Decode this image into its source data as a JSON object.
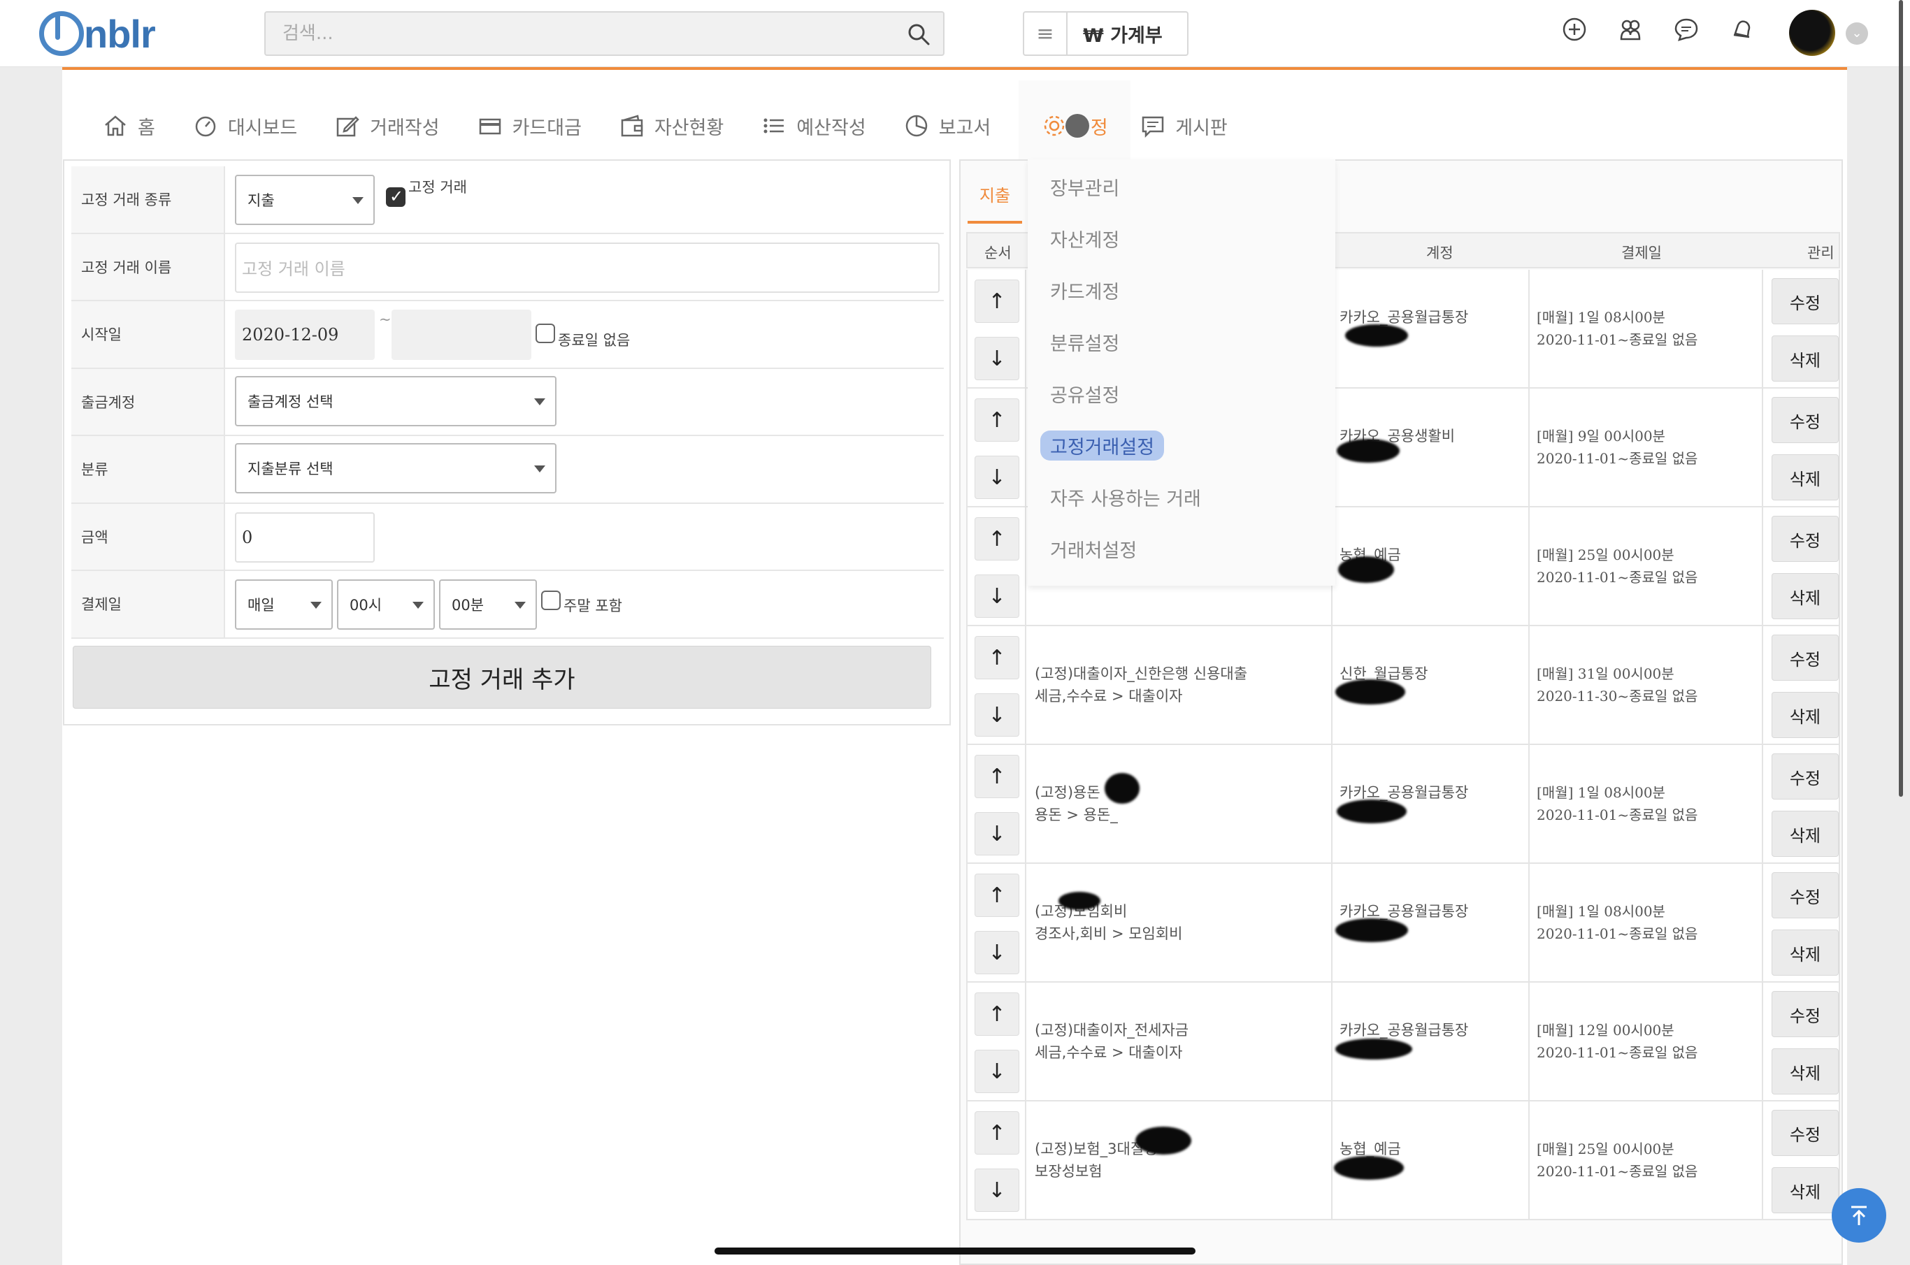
{
  "header": {
    "logo_text": "nblr",
    "search_placeholder": "검색...",
    "ledger_label": "₩  가계부"
  },
  "nav": [
    {
      "label": "홈",
      "icon": "home-icon"
    },
    {
      "label": "대시보드",
      "icon": "gauge-icon"
    },
    {
      "label": "거래작성",
      "icon": "edit-icon"
    },
    {
      "label": "카드대금",
      "icon": "card-icon"
    },
    {
      "label": "자산현황",
      "icon": "wallet-icon"
    },
    {
      "label": "예산작성",
      "icon": "list-icon"
    },
    {
      "label": "보고서",
      "icon": "pie-icon"
    },
    {
      "label": "정",
      "icon": "gear-icon"
    },
    {
      "label": "게시판",
      "icon": "board-icon"
    }
  ],
  "settings_menu": [
    {
      "label": "장부관리"
    },
    {
      "label": "자산계정"
    },
    {
      "label": "카드계정"
    },
    {
      "label": "분류설정"
    },
    {
      "label": "공유설정"
    },
    {
      "label": "고정거래설정",
      "active": true
    },
    {
      "label": "자주 사용하는 거래"
    },
    {
      "label": "거래처설정"
    }
  ],
  "form": {
    "labels": {
      "type": "고정 거래 종류",
      "name": "고정 거래 이름",
      "start": "시작일",
      "account": "출금계정",
      "category": "분류",
      "amount": "금액",
      "payday": "결제일"
    },
    "type_value": "지출",
    "recurring_label": "고정 거래",
    "name_placeholder": "고정 거래 이름",
    "start_date": "2020-12-09",
    "tilde": "~",
    "no_end_label": "종료일 없음",
    "account_select": "출금계정 선택",
    "category_select": "지출분류 선택",
    "amount_value": "0",
    "pay_period": "매일",
    "pay_hour": "00시",
    "pay_minute": "00분",
    "weekend_label": "주말 포함",
    "add_button": "고정 거래 추가"
  },
  "list": {
    "tab": "지출",
    "headers": {
      "order": "순서",
      "account": "계정",
      "payday": "결제일",
      "manage": "관리"
    },
    "up_arrow": "↑",
    "down_arrow": "↓",
    "edit_label": "수정",
    "delete_label": "삭제",
    "rows": [
      {
        "name": "",
        "category": "",
        "account": "카카오_공용월급통장",
        "schedule": "[매월] 1일 08시00분",
        "range": "2020-11-01~종료일 없음"
      },
      {
        "name": "",
        "category": "",
        "account": "카카오_공용생활비",
        "schedule": "[매월] 9일 00시00분",
        "range": "2020-11-01~종료일 없음"
      },
      {
        "name": "",
        "category": "",
        "account": "농협_예금",
        "schedule": "[매월] 25일 00시00분",
        "range": "2020-11-01~종료일 없음"
      },
      {
        "name": "(고정)대출이자_신한은행 신용대출",
        "category": "세금,수수료 > 대출이자",
        "account": "신한_월급통장",
        "schedule": "[매월] 31일 00시00분",
        "range": "2020-11-30~종료일 없음"
      },
      {
        "name": "(고정)용돈",
        "category": "용돈 > 용돈_",
        "account": "카카오_공용월급통장",
        "schedule": "[매월] 1일 08시00분",
        "range": "2020-11-01~종료일 없음"
      },
      {
        "name": "(고정)모임회비",
        "category": "경조사,회비 > 모임회비",
        "account": "카카오_공용월급통장",
        "schedule": "[매월] 1일 08시00분",
        "range": "2020-11-01~종료일 없음"
      },
      {
        "name": "(고정)대출이자_전세자금",
        "category": "세금,수수료 > 대출이자",
        "account": "카카오_공용월급통장",
        "schedule": "[매월] 12일 00시00분",
        "range": "2020-11-01~종료일 없음"
      },
      {
        "name": "(고정)보험_3대질병",
        "category": "보장성보험",
        "account": "농협_예금",
        "schedule": "[매월] 25일 00시00분",
        "range": "2020-11-01~종료일 없음"
      }
    ]
  },
  "colors": {
    "accent": "#f08b3c",
    "brand": "#3a74b4",
    "fab": "#3b84d9"
  }
}
